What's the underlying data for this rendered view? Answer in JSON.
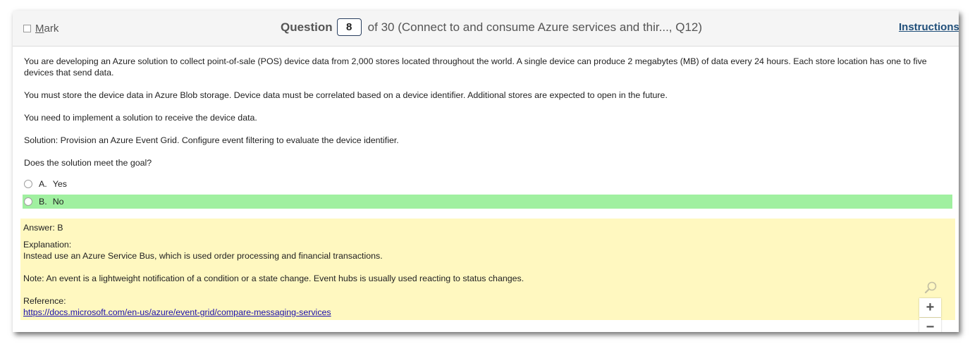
{
  "header": {
    "mark_label_first": "M",
    "mark_label_rest": "ark",
    "question_word": "Question",
    "question_number": "8",
    "question_suffix": "of 30 (Connect to and consume Azure services and thir..., Q12)",
    "instructions_label": "Instructions"
  },
  "question": {
    "paragraphs": [
      "You are developing an Azure solution to collect point-of-sale (POS) device data from 2,000 stores located throughout the world. A single device can produce 2 megabytes (MB) of data every 24 hours. Each store location has one to five devices that send data.",
      "You must store the device data in Azure Blob storage. Device data must be correlated based on a device identifier. Additional stores are expected to open in the future.",
      "You need to implement a solution to receive the device data.",
      "Solution: Provision an Azure Event Grid. Configure event filtering to evaluate the device identifier.",
      "Does the solution meet the goal?"
    ],
    "options": [
      {
        "letter": "A.",
        "text": "Yes"
      },
      {
        "letter": "B.",
        "text": "No"
      }
    ]
  },
  "answer": {
    "answer_line": "Answer: B",
    "explanation_label": "Explanation:",
    "explanation_text": "Instead use an Azure Service Bus, which is used order processing and financial transactions.",
    "note_text": "Note: An event is a lightweight notification of a condition or a state change. Event hubs is usually used reacting to status changes.",
    "reference_label": "Reference:",
    "reference_link": "https://docs.microsoft.com/en-us/azure/event-grid/compare-messaging-services"
  },
  "zoom": {
    "plus_label": "+",
    "minus_label": "−"
  },
  "colors": {
    "selected_option_bg": "#a0f0a0",
    "answer_panel_bg": "#fff8c0",
    "instructions_color": "#1f4e79"
  },
  "icons": [
    "checkbox-icon",
    "radio-icon",
    "magnifier-icon"
  ]
}
